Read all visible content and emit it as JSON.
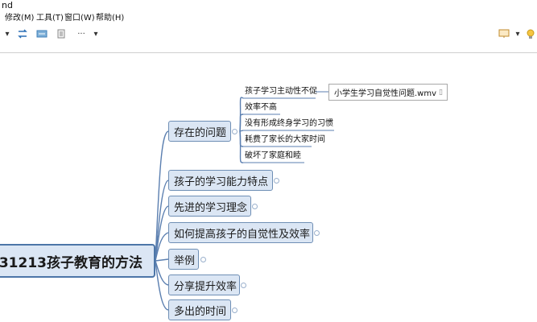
{
  "window": {
    "title": "nd"
  },
  "menu": [
    "修改(M)",
    "工具(T)",
    "窗口(W)",
    "帮助(H)"
  ],
  "toolbar": {
    "dropdown_arrow": "▾",
    "more": "···"
  },
  "mindmap": {
    "root": "31213孩子教育的方法",
    "topics": [
      {
        "label": "存在的问题"
      },
      {
        "label": "孩子的学习能力特点"
      },
      {
        "label": "先进的学习理念"
      },
      {
        "label": "如何提高孩子的自觉性及效率"
      },
      {
        "label": "举例"
      },
      {
        "label": "分享提升效率"
      },
      {
        "label": "多出的时间"
      }
    ],
    "subtopics": [
      "孩子学习主动性不促",
      "效率不高",
      "没有形成终身学习的习惯",
      "耗费了家长的大家时间",
      "破坏了家庭和睦"
    ],
    "attachment": "小学生学习自觉性问题.wmv",
    "colors": {
      "node_fill": "#dbe6f4",
      "node_border": "#6f8fb5",
      "line": "#5b7fb0"
    }
  }
}
